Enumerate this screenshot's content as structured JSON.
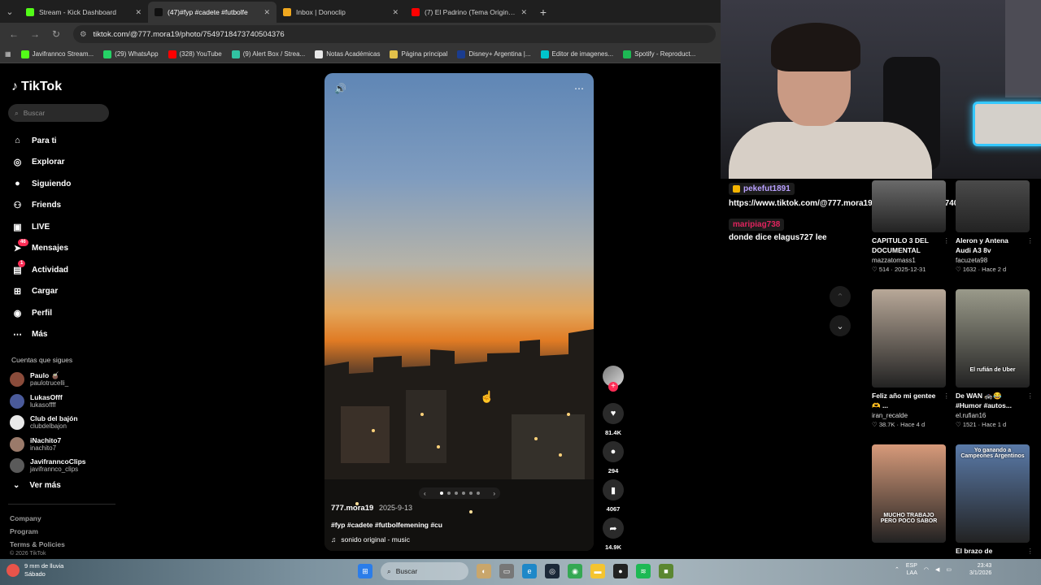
{
  "browser": {
    "tabs": [
      {
        "title": "Stream - Kick Dashboard",
        "favicon_color": "#53fc18",
        "active": false
      },
      {
        "title": "(47)#fyp #cadete #futbolfe",
        "favicon_color": "#111111",
        "active": true
      },
      {
        "title": "Inbox | Donoclip",
        "favicon_color": "#f0a81f",
        "active": false
      },
      {
        "title": "(7) El Padrino (Tema Original)/T",
        "favicon_color": "#ff0000",
        "active": false
      }
    ],
    "url": "tiktok.com/@777.mora19/photo/7549718473740504376",
    "bookmarks": [
      {
        "label": "Javifrannco Stream...",
        "color": "#53fc18"
      },
      {
        "label": "(29) WhatsApp",
        "color": "#25d366"
      },
      {
        "label": "(328) YouTube",
        "color": "#ff0000"
      },
      {
        "label": "(9) Alert Box / Strea...",
        "color": "#31c3a2"
      },
      {
        "label": "Notas Académicas",
        "color": "#e8e8e8"
      },
      {
        "label": "Página principal",
        "color": "#e2c14a"
      },
      {
        "label": "Disney+ Argentina |...",
        "color": "#1a3c8f"
      },
      {
        "label": "Editor de imagenes...",
        "color": "#00c4cc"
      },
      {
        "label": "Spotify - Reproduct...",
        "color": "#1db954"
      }
    ]
  },
  "tiktok": {
    "logo": "TikTok",
    "search_placeholder": "Buscar",
    "nav": [
      {
        "label": "Para ti",
        "icon": "home-icon"
      },
      {
        "label": "Explorar",
        "icon": "compass-icon"
      },
      {
        "label": "Siguiendo",
        "icon": "following-icon"
      },
      {
        "label": "Friends",
        "icon": "friends-icon"
      },
      {
        "label": "LIVE",
        "icon": "live-icon"
      },
      {
        "label": "Mensajes",
        "icon": "messages-icon",
        "badge": "46"
      },
      {
        "label": "Actividad",
        "icon": "activity-icon",
        "badge": "1"
      },
      {
        "label": "Cargar",
        "icon": "upload-icon"
      },
      {
        "label": "Perfil",
        "icon": "profile-icon"
      },
      {
        "label": "Más",
        "icon": "more-icon"
      }
    ],
    "following_title": "Cuentas que sigues",
    "following": [
      {
        "name": "Paulo 🧉",
        "handle": "paulotrucelli_",
        "color": "#8a4b3a"
      },
      {
        "name": "LukasOfff",
        "handle": "lukasoffff",
        "color": "#4a5a9a"
      },
      {
        "name": "Club del bajón",
        "handle": "clubdelbajon",
        "color": "#e8e8e8"
      },
      {
        "name": "iNachito7",
        "handle": "inachito7",
        "color": "#9a7a6a"
      },
      {
        "name": "JavifranncoClips",
        "handle": "javifrannco_clips",
        "color": "#5a5a5a"
      }
    ],
    "see_more": "Ver más",
    "footer": [
      "Company",
      "Program",
      "Terms & Policies"
    ],
    "copyright": "© 2026 TikTok"
  },
  "video": {
    "username": "777.mora19",
    "date": "2025-9-13",
    "caption": "#fyp #cadete #futbolfemening #cu",
    "sound": "sonido original - music",
    "likes": "81.4K",
    "comments": "294",
    "saves": "4067",
    "shares": "14.9K",
    "carousel_pages": 6,
    "carousel_current": 1
  },
  "chat": [
    {
      "user": "pekefut1891",
      "user_color": "#b9a0ff",
      "text": "https://www.tiktok.com/@777.mora19/photo/7549718473740504376",
      "crown": true
    },
    {
      "user": "maripiag738",
      "user_color": "#e0245e",
      "text": "donde dice elagus727 lee",
      "crown": false
    }
  ],
  "recommended": [
    {
      "title": "CAPITULO 3 DEL DOCUMENTAL",
      "user": "mazzatomass1",
      "likes": "514",
      "when": "2025-12-31",
      "color": "#6a6a6a"
    },
    {
      "title": "Aleron y Antena Audi A3 8v",
      "user": "facuzeta98",
      "likes": "1632",
      "when": "Hace 2 d",
      "color": "#4a4a4a"
    },
    {
      "title": "Feliz año mi gentee🫶 ...",
      "user": "iran_recalde",
      "likes": "38.7K",
      "when": "Hace 4 d",
      "color": "#b8a898",
      "overlay": ""
    },
    {
      "title": "De WAN 🚓😂 #Humor #autos...",
      "user": "el.rufian16",
      "likes": "1521",
      "when": "Hace 1 d",
      "color": "#9a9a8a",
      "overlay": "El rufián de Uber"
    },
    {
      "title": "",
      "user": "",
      "likes": "",
      "when": "",
      "color": "#d79a7a",
      "overlay": "MUCHO TRABAJO PERO POCO SABOR"
    },
    {
      "title": "El brazo de",
      "user": "",
      "likes": "",
      "when": "",
      "color": "#5a7aa8",
      "overlay": "Yo ganando a Campeones Argentinos"
    }
  ],
  "taskbar": {
    "weather_line1": "9 mm de lluvia",
    "weather_line2": "Sábado",
    "search": "Buscar",
    "lang": "ESP",
    "lang2": "LAA",
    "time": "23:43",
    "date": "3/1/2026"
  }
}
